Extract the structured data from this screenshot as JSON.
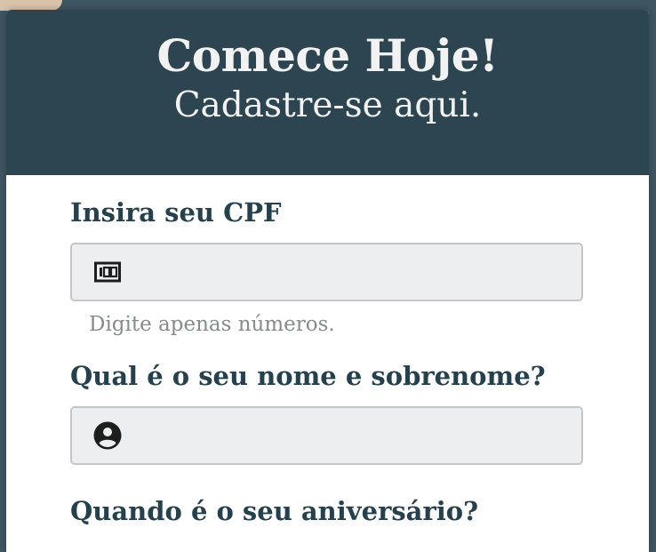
{
  "header": {
    "title": "Comece Hoje!",
    "subtitle": "Cadastre-se aqui."
  },
  "form": {
    "cpf": {
      "label": "Insira seu CPF",
      "value": "",
      "placeholder": "",
      "icon": "numeric-keypad-icon",
      "hint": "Digite apenas números."
    },
    "name": {
      "label": "Qual é o seu nome e sobrenome?",
      "value": "",
      "placeholder": "",
      "icon": "account-circle-icon"
    },
    "birthday": {
      "label": "Quando é o seu aniversário?"
    }
  },
  "colors": {
    "header_bg": "#2c4550",
    "label_text": "#25414d",
    "input_bg": "#eceeef",
    "hint_text": "#878b8d"
  }
}
